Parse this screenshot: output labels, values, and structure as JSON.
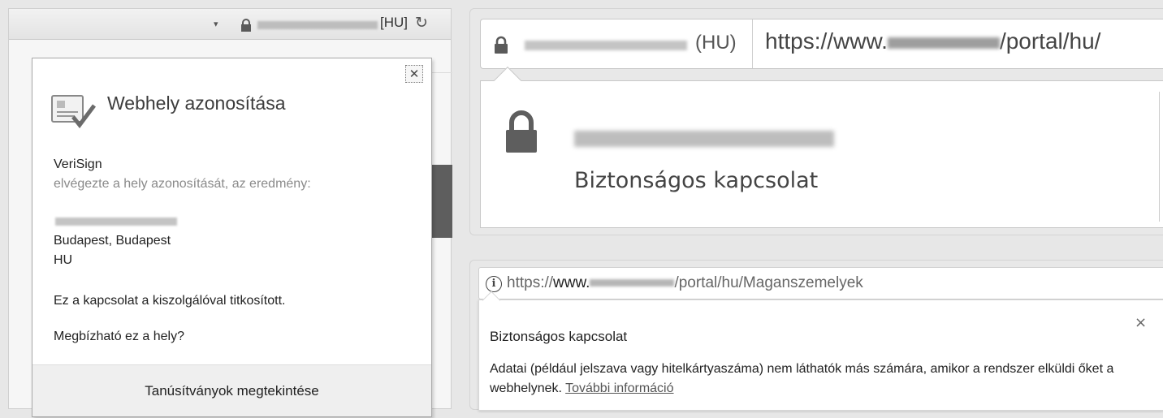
{
  "ie": {
    "country": "[HU]",
    "dropdown_glyph": "▾",
    "refresh_glyph": "↻",
    "close_glyph": "✕",
    "popup": {
      "title": "Webhely azonosítása",
      "issuer": "VeriSign",
      "issuer_note": "elvégezte a hely azonosítását, az eredmény:",
      "location": "Budapest, Budapest",
      "country_code": "HU",
      "encrypted": "Ez a kapcsolat a kiszolgálóval titkosított.",
      "trust_question": "Megbízható ez a hely?",
      "view_certs": "Tanúsítványok megtekintése"
    }
  },
  "chrome_old": {
    "country": "(HU)",
    "url_prefix": "https://www.",
    "url_suffix": "/portal/hu/",
    "secure_text": "Biztonságos kapcsolat"
  },
  "chrome_new": {
    "info_glyph": "i",
    "url_scheme": "https://",
    "url_host_prefix": "www.",
    "url_path": "/portal/hu/Maganszemelyek",
    "title": "Biztonságos kapcsolat",
    "close_glyph": "×",
    "desc": "Adatai (például jelszava vagy hitelkártyaszáma) nem láthatók más számára, amikor a rendszer elküldi őket a webhelynek. ",
    "more_link": "További információ"
  },
  "colors": {
    "lock": "#5a5a5a",
    "background": "#e7e7e7"
  }
}
